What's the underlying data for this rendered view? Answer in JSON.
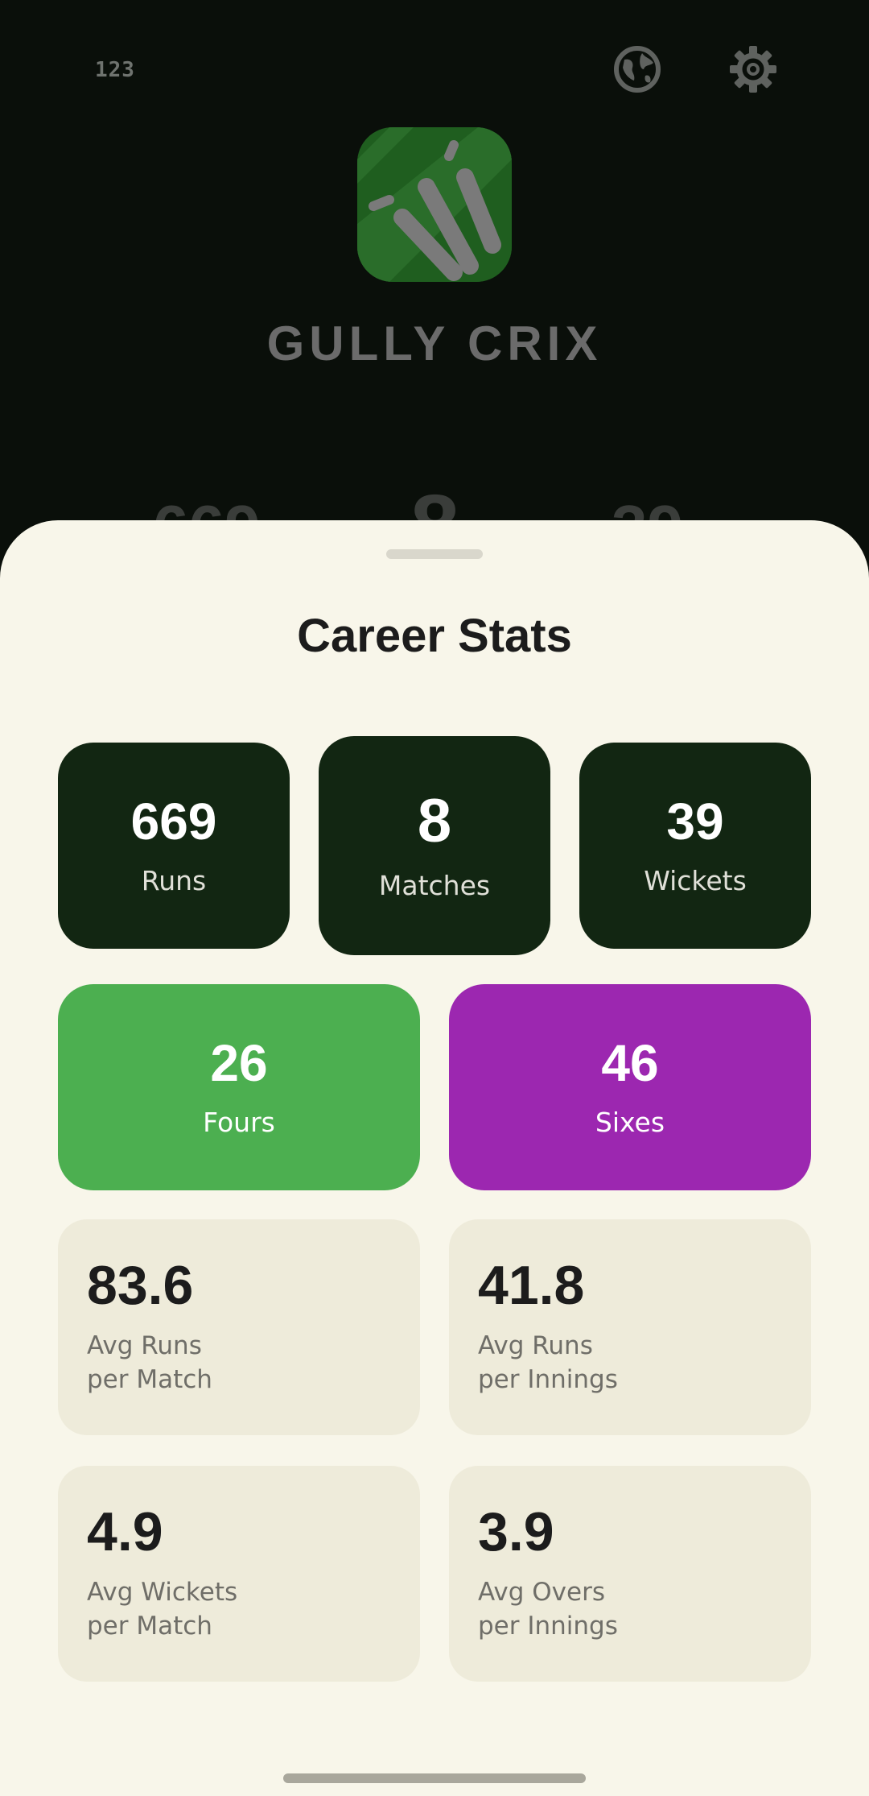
{
  "header": {
    "numeric_badge": "123",
    "globe_icon": "globe-icon",
    "settings_icon": "gear-icon",
    "app_name": "GULLY CRIX",
    "peek_left": "669",
    "peek_mid": "8",
    "peek_right": "39"
  },
  "sheet": {
    "title": "Career Stats",
    "primary": [
      {
        "value": "669",
        "label": "Runs"
      },
      {
        "value": "8",
        "label": "Matches"
      },
      {
        "value": "39",
        "label": "Wickets"
      }
    ],
    "boundaries": [
      {
        "value": "26",
        "label": "Fours",
        "color": "#4caf50"
      },
      {
        "value": "46",
        "label": "Sixes",
        "color": "#9c27b0"
      }
    ],
    "averages": [
      {
        "value": "83.6",
        "line1": "Avg Runs",
        "line2": "per Match"
      },
      {
        "value": "41.8",
        "line1": "Avg Runs",
        "line2": "per Innings"
      },
      {
        "value": "4.9",
        "line1": "Avg Wickets",
        "line2": "per Match"
      },
      {
        "value": "3.9",
        "line1": "Avg Overs",
        "line2": "per Innings"
      }
    ]
  },
  "colors": {
    "sheet_bg": "#f8f6ea",
    "dark_card": "#122612",
    "avg_card": "#eeebda"
  }
}
